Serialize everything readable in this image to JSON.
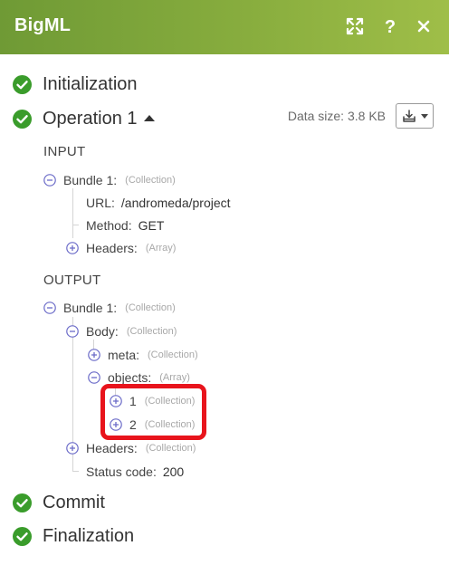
{
  "header": {
    "title": "BigML"
  },
  "stages": {
    "initialization": "Initialization",
    "operation": "Operation 1",
    "commit": "Commit",
    "finalization": "Finalization"
  },
  "data_size": "Data size: 3.8 KB",
  "input": {
    "section_label": "INPUT",
    "bundle_key": "Bundle 1:",
    "bundle_type": "(Collection)",
    "url_key": "URL:",
    "url_value": "/andromeda/project",
    "method_key": "Method:",
    "method_value": "GET",
    "headers_key": "Headers:",
    "headers_type": "(Array)"
  },
  "output": {
    "section_label": "OUTPUT",
    "bundle_key": "Bundle 1:",
    "bundle_type": "(Collection)",
    "body_key": "Body:",
    "body_type": "(Collection)",
    "meta_key": "meta:",
    "meta_type": "(Collection)",
    "objects_key": "objects:",
    "objects_type": "(Array)",
    "item1_key": "1",
    "item1_type": "(Collection)",
    "item2_key": "2",
    "item2_type": "(Collection)",
    "headers_key": "Headers:",
    "headers_type": "(Collection)",
    "status_key": "Status code:",
    "status_value": "200"
  },
  "colors": {
    "header_green": "#7ea33b",
    "check_green": "#3a9c2b",
    "highlight_red": "#e8141c"
  }
}
